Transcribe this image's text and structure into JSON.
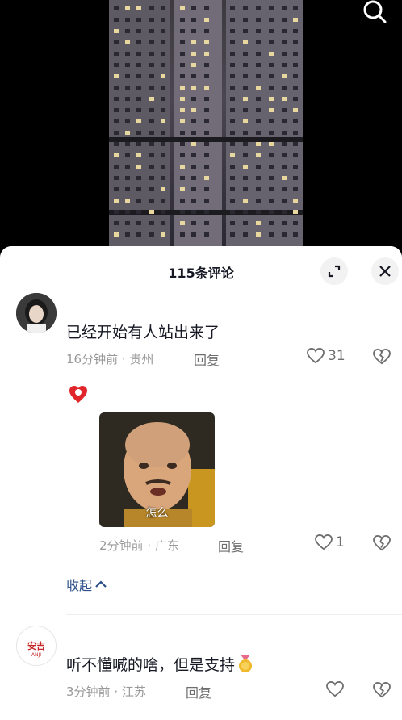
{
  "header": {
    "title": "115条评论"
  },
  "comments": [
    {
      "text": "已经开始有人站出来了",
      "time": "16分钟前",
      "location": "贵州",
      "reply": "回复",
      "likes": "31"
    },
    {
      "sticker_caption": "怎么",
      "time": "2分钟前",
      "location": "广东",
      "reply": "回复",
      "likes": "1"
    },
    {
      "text": "听不懂喊的啥，但是支持",
      "time": "3分钟前",
      "location": "江苏",
      "reply": "回复",
      "likes": ""
    }
  ],
  "collapse_label": "收起",
  "avatar3_text": "安吉",
  "avatar3_sub": "ANJI",
  "colors": {
    "accent_link": "#2c4f8a",
    "text": "#161823",
    "muted": "#9a9a9a"
  },
  "icons": [
    "search-icon",
    "expand-icon",
    "close-icon",
    "heart-icon",
    "broken-heart-icon",
    "chevron-up-icon",
    "medal-emoji-icon"
  ]
}
